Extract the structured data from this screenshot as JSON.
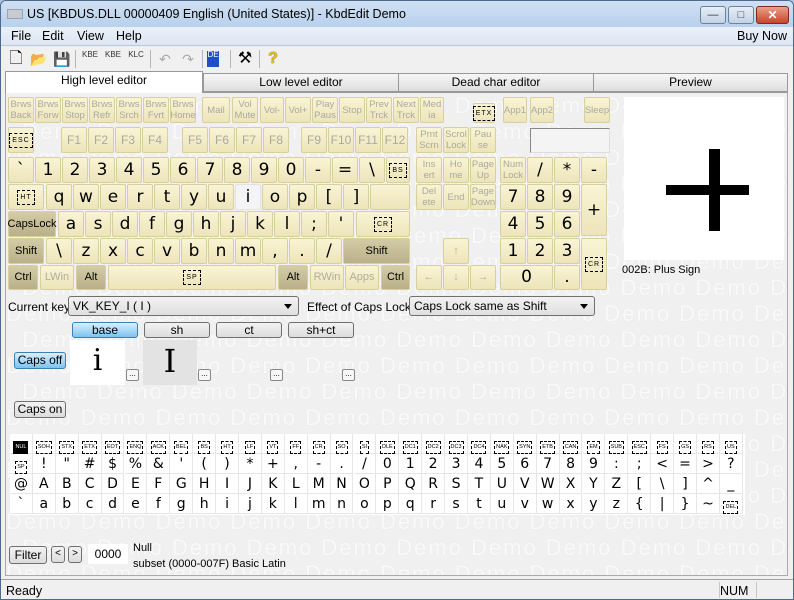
{
  "window": {
    "title": "US [KBDUS.DLL 00000409 English (United States)] - KbdEdit Demo",
    "controls": {
      "minimize": "—",
      "maximize": "□",
      "close": "✕"
    }
  },
  "menu": {
    "items": [
      "File",
      "Edit",
      "View",
      "Help"
    ],
    "buy_now": "Buy Now"
  },
  "toolbar": {
    "buttons": [
      {
        "name": "new-icon",
        "glyph": "🗋"
      },
      {
        "name": "open-icon",
        "glyph": "📂"
      },
      {
        "name": "save-icon",
        "glyph": "💾"
      },
      {
        "name": "open-kbe-icon",
        "glyph": "KBE"
      },
      {
        "name": "save-kbe-icon",
        "glyph": "KBE"
      },
      {
        "name": "open-klc-icon",
        "glyph": "KLC"
      },
      {
        "name": "undo-icon",
        "glyph": "↶"
      },
      {
        "name": "redo-icon",
        "glyph": "↷"
      },
      {
        "name": "language-icon",
        "glyph": "DE"
      },
      {
        "name": "tools-icon",
        "glyph": "⚒"
      },
      {
        "name": "help-icon",
        "glyph": "?"
      }
    ]
  },
  "tabs": [
    "High level editor",
    "Low level editor",
    "Dead char editor",
    "Preview"
  ],
  "active_tab": "High level editor",
  "keyboard": {
    "media_row": [
      "Brws\nBack",
      "Brws\nForw",
      "Brws\nStop",
      "Brws\nRefr",
      "Brws\nSrch",
      "Brws\nFvrt",
      "Brws\nHome",
      "Mail",
      "Vol\nMute",
      "Vol-",
      "Vol+",
      "Play\nPaus",
      "Stop",
      "Prev\nTrck",
      "Next\nTrck",
      "Med\nia"
    ],
    "etx": "ETX",
    "app_keys": [
      "App1",
      "App2",
      "Sleep"
    ],
    "esc": "ESC",
    "f_keys": [
      "F1",
      "F2",
      "F3",
      "F4",
      "F5",
      "F6",
      "F7",
      "F8",
      "F9",
      "F10",
      "F11",
      "F12"
    ],
    "sys_keys": [
      "Prnt\nScrn",
      "Scrol\nLock",
      "Pau\nse"
    ],
    "number_row": [
      "`",
      "1",
      "2",
      "3",
      "4",
      "5",
      "6",
      "7",
      "8",
      "9",
      "0",
      "-",
      "=",
      "\\"
    ],
    "bs": "BS",
    "nav_top": [
      "Ins\nert",
      "Ho\nme",
      "Page\nUp"
    ],
    "nav_bottom": [
      "Del\nete",
      "End",
      "Page\nDown"
    ],
    "numpad_top": [
      "Num\nLock",
      "/",
      "*",
      "-"
    ],
    "ht": "HT",
    "q_row": [
      "q",
      "w",
      "e",
      "r",
      "t",
      "y",
      "u",
      "i",
      "o",
      "p",
      "[",
      "]"
    ],
    "selected_key": "i",
    "numpad_789": [
      "7",
      "8",
      "9"
    ],
    "numpad_plus": "+",
    "capslock": "CapsLock",
    "a_row": [
      "a",
      "s",
      "d",
      "f",
      "g",
      "h",
      "j",
      "k",
      "l",
      ";",
      "'"
    ],
    "cr": "CR",
    "numpad_456": [
      "4",
      "5",
      "6"
    ],
    "shift": "Shift",
    "z_row": [
      "\\",
      "z",
      "x",
      "c",
      "v",
      "b",
      "n",
      "m",
      ",",
      ".",
      "/"
    ],
    "arrow_up": "↑",
    "numpad_123": [
      "1",
      "2",
      "3"
    ],
    "bottom_row": {
      "ctrl": "Ctrl",
      "lwin": "LWin",
      "alt": "Alt",
      "sp": "SP",
      "rwin": "RWin",
      "apps": "Apps"
    },
    "arrows": [
      "←",
      "↓",
      "→"
    ],
    "numpad_0": "0",
    "numpad_dot": "."
  },
  "glyph_preview": {
    "char": "+",
    "label": "002B: Plus Sign"
  },
  "editor": {
    "current_key_label": "Current key",
    "current_key_value": "VK_KEY_I ( I )",
    "caps_effect_label": "Effect of Caps Lock",
    "caps_effect_value": "Caps Lock same as Shift",
    "shift_states": [
      "base",
      "sh",
      "ct",
      "sh+ct"
    ],
    "active_state": "base",
    "caps_off": "Caps off",
    "caps_on": "Caps on",
    "base_char": "i",
    "shift_char": "I",
    "more_button": "..."
  },
  "charmap": {
    "rows": [
      [
        "NUL",
        "SOH",
        "STX",
        "ETX",
        "EOT",
        "ENQ",
        "ACK",
        "BEL",
        "BS",
        "HT",
        "LF",
        "VT",
        "FF",
        "CR",
        "SO",
        "SI",
        "DLE",
        "DC1",
        "DC2",
        "DC3",
        "DC4",
        "NAK",
        "SYN",
        "ETB",
        "CAN",
        "EM",
        "SUB",
        "ESC",
        "FS",
        "GS",
        "RS",
        "US"
      ],
      [
        "SP",
        "!",
        "\"",
        "#",
        "$",
        "%",
        "&",
        "'",
        "(",
        ")",
        "*",
        "+",
        ",",
        "-",
        ".",
        "/",
        "0",
        "1",
        "2",
        "3",
        "4",
        "5",
        "6",
        "7",
        "8",
        "9",
        ":",
        ";",
        "<",
        "=",
        ">",
        "?"
      ],
      [
        "@",
        "A",
        "B",
        "C",
        "D",
        "E",
        "F",
        "G",
        "H",
        "I",
        "J",
        "K",
        "L",
        "M",
        "N",
        "O",
        "P",
        "Q",
        "R",
        "S",
        "T",
        "U",
        "V",
        "W",
        "X",
        "Y",
        "Z",
        "[",
        "\\",
        "]",
        "^",
        "_"
      ],
      [
        "`",
        "a",
        "b",
        "c",
        "d",
        "e",
        "f",
        "g",
        "h",
        "i",
        "j",
        "k",
        "l",
        "m",
        "n",
        "o",
        "p",
        "q",
        "r",
        "s",
        "t",
        "u",
        "v",
        "w",
        "x",
        "y",
        "z",
        "{",
        "|",
        "}",
        "~",
        "DEL"
      ]
    ],
    "selected": "NUL"
  },
  "bottom": {
    "filter": "Filter",
    "prev": "<",
    "next": ">",
    "code": "0000",
    "char_name": "Null",
    "subset": "subset (0000-007F) Basic Latin"
  },
  "status": {
    "text": "Ready",
    "num": "NUM"
  },
  "watermark": "Demo"
}
